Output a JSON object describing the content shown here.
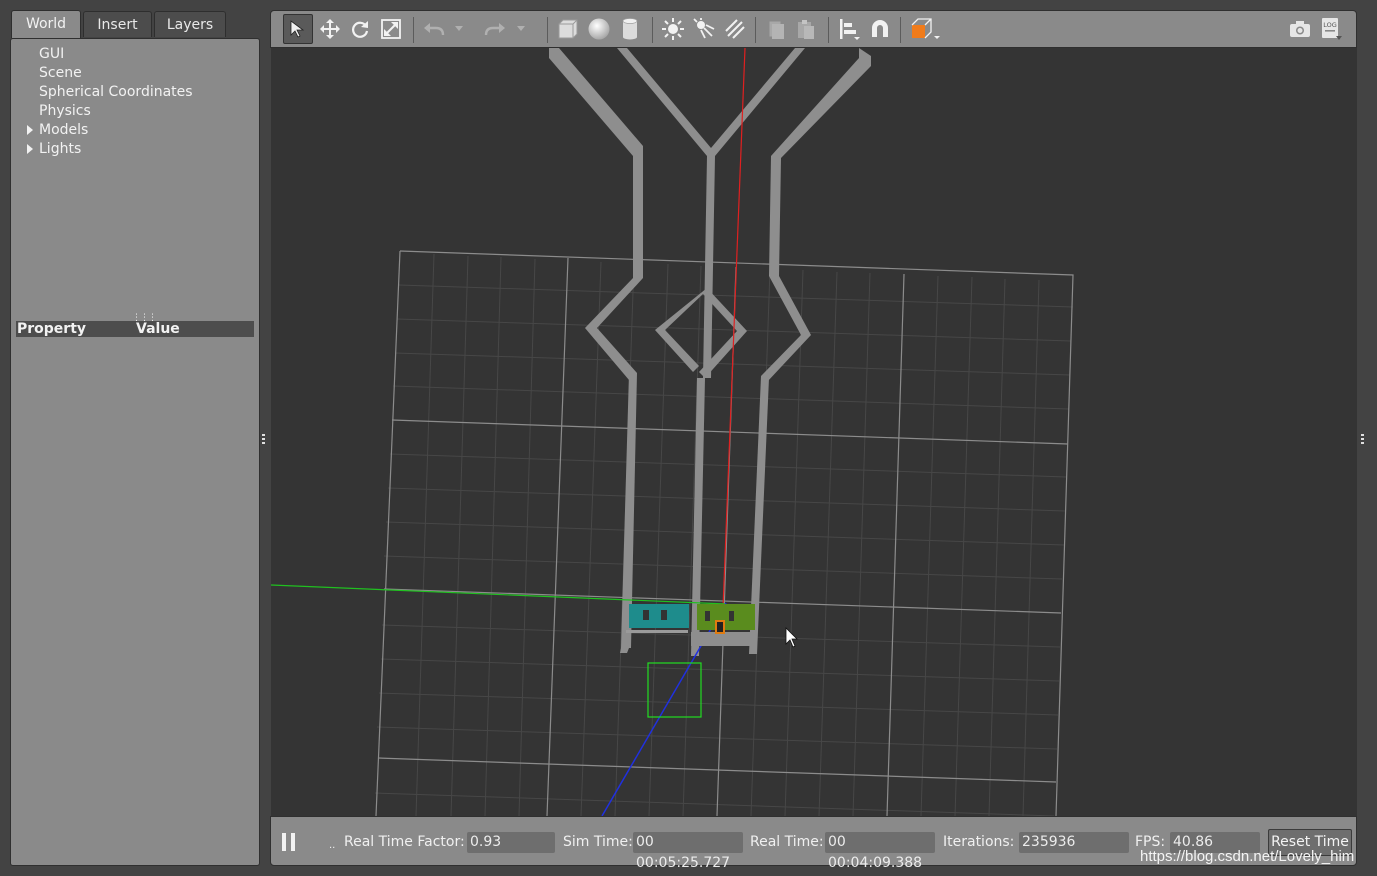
{
  "left_tabs": [
    {
      "label": "World",
      "active": true
    },
    {
      "label": "Insert",
      "active": false
    },
    {
      "label": "Layers",
      "active": false
    }
  ],
  "world_tree": [
    {
      "label": "GUI",
      "expandable": false
    },
    {
      "label": "Scene",
      "expandable": false
    },
    {
      "label": "Spherical Coordinates",
      "expandable": false
    },
    {
      "label": "Physics",
      "expandable": false
    },
    {
      "label": "Models",
      "expandable": true
    },
    {
      "label": "Lights",
      "expandable": true
    }
  ],
  "property_table": {
    "property_header": "Property",
    "value_header": "Value"
  },
  "toolbar": {
    "icons": [
      "select-arrow-icon",
      "translate-icon",
      "rotate-icon",
      "scale-icon",
      "undo-icon",
      "undo-dropdown-icon",
      "redo-icon",
      "redo-dropdown-icon",
      "box-icon",
      "sphere-icon",
      "cylinder-icon",
      "point-light-icon",
      "spot-light-icon",
      "directional-light-icon",
      "copy-icon",
      "paste-icon",
      "align-icon",
      "snap-magnet-icon",
      "view-angle-icon",
      "screenshot-camera-icon",
      "log-record-icon"
    ],
    "log_label": "LOG",
    "active_tool": "select-arrow-icon",
    "accent_color": "#f07b1a"
  },
  "status_bar": {
    "real_time_factor_label": "Real Time Factor:",
    "real_time_factor_value": "0.93",
    "sim_time_label": "Sim Time:",
    "sim_time_value": "00 00:05:25.727",
    "real_time_label": "Real Time:",
    "real_time_value": "00 00:04:09.388",
    "iterations_label": "Iterations:",
    "iterations_value": "235936",
    "fps_label": "FPS:",
    "fps_value": "40.86",
    "reset_time_label": "Reset Time",
    "step_indicator": ".."
  },
  "watermark": "https://blog.csdn.net/Lovely_him",
  "scene_colors": {
    "background": "#343434",
    "grid": "#4a4a4a",
    "grid_major": "#8c8c8c",
    "walls": "#8e8e8e",
    "x_axis": "#e02020",
    "y_axis": "#20c020",
    "z_axis": "#2030e0",
    "bounding_box": "#22dd22",
    "teal_block": "#1e8c8c",
    "green_block": "#5a8c1e"
  }
}
